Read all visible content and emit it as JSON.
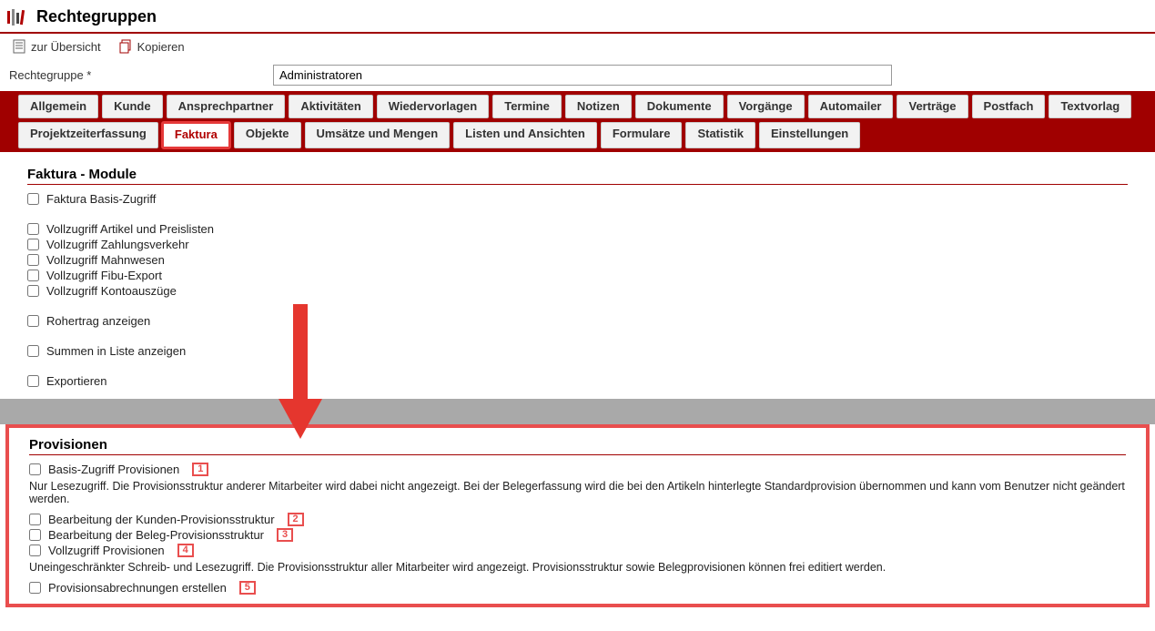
{
  "page": {
    "title": "Rechtegruppen"
  },
  "toolbar": {
    "overview": "zur Übersicht",
    "copy": "Kopieren"
  },
  "field": {
    "label": "Rechtegruppe *",
    "value": "Administratoren"
  },
  "tabs_row1": [
    {
      "label": "Allgemein"
    },
    {
      "label": "Kunde"
    },
    {
      "label": "Ansprechpartner"
    },
    {
      "label": "Aktivitäten"
    },
    {
      "label": "Wiedervorlagen"
    },
    {
      "label": "Termine"
    },
    {
      "label": "Notizen"
    },
    {
      "label": "Dokumente"
    },
    {
      "label": "Vorgänge"
    },
    {
      "label": "Automailer"
    },
    {
      "label": "Verträge"
    },
    {
      "label": "Postfach"
    },
    {
      "label": "Textvorlag"
    }
  ],
  "tabs_row2": [
    {
      "label": "Projektzeiterfassung"
    },
    {
      "label": "Faktura",
      "active": true
    },
    {
      "label": "Objekte"
    },
    {
      "label": "Umsätze und Mengen"
    },
    {
      "label": "Listen und Ansichten"
    },
    {
      "label": "Formulare"
    },
    {
      "label": "Statistik"
    },
    {
      "label": "Einstellungen"
    }
  ],
  "section_module": {
    "title": "Faktura - Module",
    "items_a": [
      {
        "label": "Faktura Basis-Zugriff"
      }
    ],
    "items_b": [
      {
        "label": "Vollzugriff Artikel und Preislisten"
      },
      {
        "label": "Vollzugriff Zahlungsverkehr"
      },
      {
        "label": "Vollzugriff Mahnwesen"
      },
      {
        "label": "Vollzugriff Fibu-Export"
      },
      {
        "label": "Vollzugriff Kontoauszüge"
      }
    ],
    "items_c": [
      {
        "label": "Rohertrag anzeigen"
      }
    ],
    "items_d": [
      {
        "label": "Summen in Liste anzeigen"
      }
    ],
    "items_e": [
      {
        "label": "Exportieren"
      }
    ]
  },
  "section_prov": {
    "title": "Provisionen",
    "item1": {
      "label": "Basis-Zugriff Provisionen",
      "num": "1"
    },
    "help1": "Nur Lesezugriff. Die Provisionsstruktur anderer Mitarbeiter wird dabei nicht angezeigt. Bei der Belegerfassung wird die bei den Artikeln hinterlegte Standardprovision übernommen und kann vom Benutzer nicht geändert werden.",
    "item2": {
      "label": "Bearbeitung der Kunden-Provisionsstruktur",
      "num": "2"
    },
    "item3": {
      "label": "Bearbeitung der Beleg-Provisionsstruktur",
      "num": "3"
    },
    "item4": {
      "label": "Vollzugriff Provisionen",
      "num": "4"
    },
    "help2": "Uneingeschränkter Schreib- und Lesezugriff. Die Provisionsstruktur aller Mitarbeiter wird angezeigt. Provisionsstruktur sowie Belegprovisionen können frei editiert werden.",
    "item5": {
      "label": "Provisionsabrechnungen erstellen",
      "num": "5"
    }
  }
}
